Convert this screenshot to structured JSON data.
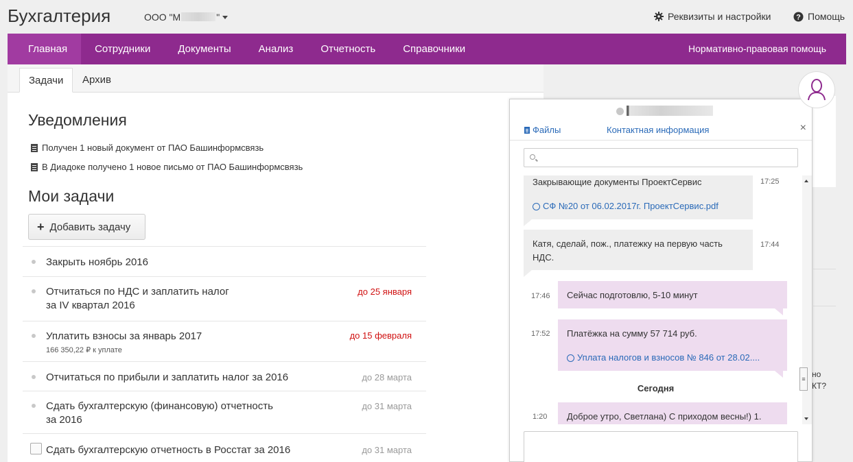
{
  "app": {
    "title": "Бухгалтерия",
    "org_prefix": "ООО \"М",
    "org_suffix": "\""
  },
  "top_links": {
    "settings": "Реквизиты и настройки",
    "help": "Помощь"
  },
  "nav": {
    "items": [
      "Главная",
      "Сотрудники",
      "Документы",
      "Анализ",
      "Отчетность",
      "Справочники"
    ],
    "active": "Главная",
    "right": "Нормативно-правовая помощь"
  },
  "tabs": {
    "tasks": "Задачи",
    "archive": "Архив"
  },
  "notifications": {
    "title": "Уведомления",
    "items": [
      "Получен 1 новый документ от ПАО Башинформсвязь",
      "В Диадоке получено 1 новое письмо от ПАО Башинформсвязь"
    ]
  },
  "my_tasks": {
    "title": "Мои задачи",
    "add_label": "Добавить задачу",
    "items": [
      {
        "line1": "Закрыть ноябрь 2016",
        "line2": "",
        "sub": "",
        "due": ""
      },
      {
        "line1": "Отчитаться по НДС и заплатить налог",
        "line2": "за IV квартал 2016",
        "sub": "",
        "due": "до 25 января"
      },
      {
        "line1": "Уплатить взносы за январь 2017",
        "line2": "",
        "sub": "166 350,22 ₽ к уплате",
        "due": "до 15 февраля"
      },
      {
        "line1": "Отчитаться по прибыли и заплатить налог за 2016",
        "line2": "",
        "sub": "",
        "due": "до 28 марта"
      },
      {
        "line1": "Сдать бухгалтерскую (финансовую) отчетность",
        "line2": "за 2016",
        "sub": "",
        "due": "до 31 марта"
      },
      {
        "line1": "Сдать бухгалтерскую отчетность в Росстат за 2016",
        "line2": "",
        "sub": "",
        "due": "до 31 марта"
      }
    ]
  },
  "right_edge": {
    "text1": "но",
    "text2": "КТ?"
  },
  "chat": {
    "files_label": "Файлы",
    "contact_label": "Контактная информация",
    "close": "×",
    "search_placeholder": "",
    "day_separator": "Сегодня",
    "messages": [
      {
        "dir": "in",
        "text": "Закрывающие документы ПроектСервис",
        "attachment": "СФ №20 от 06.02.2017г. ПроектСервис.pdf",
        "time": "17:25"
      },
      {
        "dir": "in",
        "text": "Катя, сделай, пож., платежку на первую часть",
        "text2": "НДС.",
        "time": "17:44"
      },
      {
        "dir": "out",
        "text": "Сейчас подготовлю, 5-10 минут",
        "time": "17:46"
      },
      {
        "dir": "out",
        "text": "Платёжка на сумму 57 714 руб.",
        "attachment": "Уплата налогов и взносов № 846 от 28.02....",
        "time": "17:52"
      },
      {
        "dir": "out",
        "text": "Доброе утро, Светлана) С приходом весны!) 1.",
        "time": "1:20"
      }
    ],
    "input_placeholder": ""
  },
  "colors": {
    "brand": "#8e2a8e",
    "nav_active": "#a13ba1",
    "link": "#2a6ab8",
    "due_red": "#d01010",
    "bubble_in": "#eeeeee",
    "bubble_out": "#eedcef"
  },
  "icons": {
    "settings": "gear-icon",
    "help": "question-circle-icon",
    "doc": "document-icon",
    "attach": "paperclip-icon",
    "search": "search-icon",
    "avatar": "person-icon"
  }
}
